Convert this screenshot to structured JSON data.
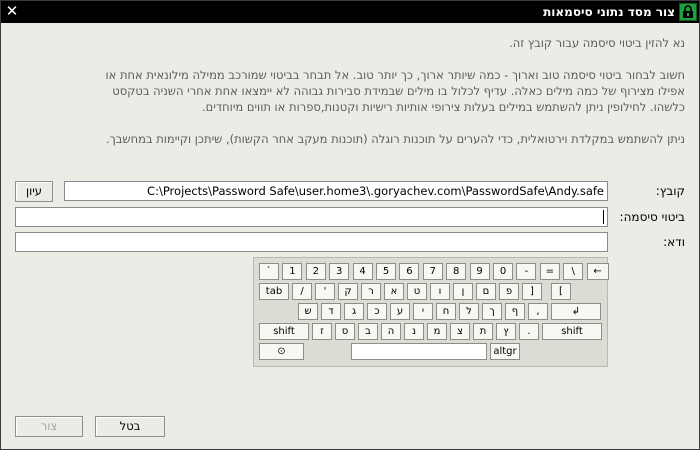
{
  "window": {
    "title": "צור מסד נתוני סיסמאות",
    "close_glyph": "✕"
  },
  "instructions": [
    "נא להזין ביטוי סיסמה עבור קובץ זה.",
    "חשוב לבחור ביטוי סיסמה טוב וארוך - כמה שיותר ארוך, כך יותר טוב. אל תבחר בביטוי שמורכב ממילה מילונאית אחת או אפילו מצירוף של כמה מילים כאלה. עדיף לכלול בו מילים שבמידת סבירות גבוהה לא יימצאו אחת אחרי השניה בטקסט כלשהו. לחילופין ניתן להשתמש במילים בעלות צירופי אותיות רישיות וקטנות,ספרות או תווים מיוחדים.",
    "ניתן להשתמש במקלדת וירטואלית, כדי להערים על תוכנות רוגלה (תוכנות מעקב אחר הקשות), שיתכן וקיימות במחשבך."
  ],
  "form": {
    "file_label": "קובץ:",
    "file_value": "C:\\Projects\\Password Safe\\user.home3\\.goryachev.com\\PasswordSafe\\Andy.safe",
    "browse_label": "עיון",
    "passphrase_label": "ביטוי סיסמה:",
    "passphrase_value": "",
    "confirm_label": "ודא:",
    "confirm_value": ""
  },
  "keyboard": {
    "rows": [
      [
        "`",
        "1",
        "2",
        "3",
        "4",
        "5",
        "6",
        "7",
        "8",
        "9",
        "0",
        "-",
        "=",
        "\\",
        "←"
      ],
      [
        "tab",
        "/",
        "'",
        "ק",
        "ר",
        "א",
        "ט",
        "ו",
        "ן",
        "ם",
        "פ",
        "]",
        "["
      ],
      [
        "ש",
        "ד",
        "ג",
        "כ",
        "ע",
        "י",
        "ח",
        "ל",
        "ך",
        "ף",
        ",",
        "↲"
      ],
      [
        "shift",
        "ז",
        "ס",
        "ב",
        "ה",
        "נ",
        "מ",
        "צ",
        "ת",
        "ץ",
        ".",
        "shift"
      ],
      [
        "⊙",
        "altgr"
      ]
    ]
  },
  "buttons": {
    "create_label": "צור",
    "cancel_label": "בטל"
  }
}
